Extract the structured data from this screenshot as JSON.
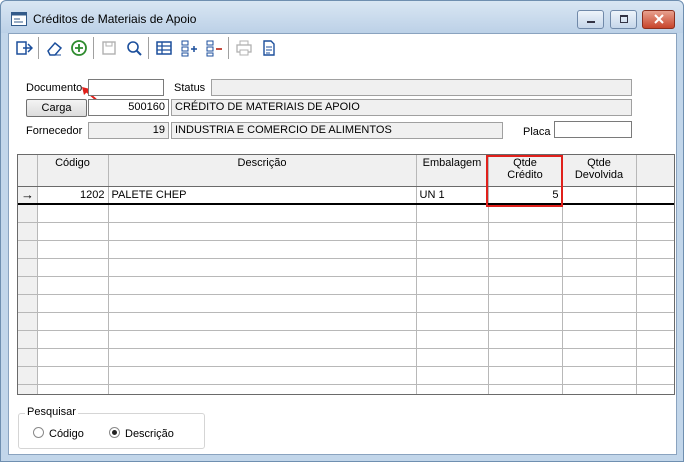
{
  "window": {
    "title": "Créditos de Materiais de Apoio"
  },
  "toolbar": {
    "buttons": [
      {
        "icon": "exit-icon",
        "enabled": true
      },
      {
        "icon": "eraser-icon",
        "enabled": true
      },
      {
        "icon": "add-circle-icon",
        "enabled": true
      },
      {
        "icon": "save-icon",
        "enabled": false
      },
      {
        "icon": "search-icon",
        "enabled": true
      },
      {
        "icon": "table-icon",
        "enabled": true
      },
      {
        "icon": "add-row-icon",
        "enabled": true
      },
      {
        "icon": "remove-row-icon",
        "enabled": true
      },
      {
        "icon": "print-icon",
        "enabled": false
      },
      {
        "icon": "report-icon",
        "enabled": true
      }
    ]
  },
  "form": {
    "documento_label": "Documento",
    "documento_value": "",
    "status_label": "Status",
    "status_value": "",
    "carga_button": "Carga",
    "carga_value": "500160",
    "carga_desc": "CRÉDITO DE MATERIAIS DE APOIO",
    "fornecedor_label": "Fornecedor",
    "fornecedor_code": "19",
    "fornecedor_name": "INDUSTRIA E COMERCIO DE ALIMENTOS",
    "placa_label": "Placa",
    "placa_value": ""
  },
  "grid": {
    "columns": [
      "Código",
      "Descrição",
      "Embalagem",
      "Qtde\nCrédito",
      "Qtde\nDevolvida"
    ],
    "rows": [
      {
        "indicator": "→",
        "codigo": "1202",
        "descricao": "PALETE CHEP",
        "embalagem": "UN 1",
        "qtde_credito": "5",
        "qtde_devolvida": ""
      }
    ]
  },
  "search": {
    "title": "Pesquisar",
    "options": [
      {
        "label": "Código",
        "selected": false
      },
      {
        "label": "Descrição",
        "selected": true
      }
    ]
  },
  "colors": {
    "highlight": "#e0201b",
    "titlebar": "#c2d6ea",
    "add_icon": "#2e8b2e"
  }
}
